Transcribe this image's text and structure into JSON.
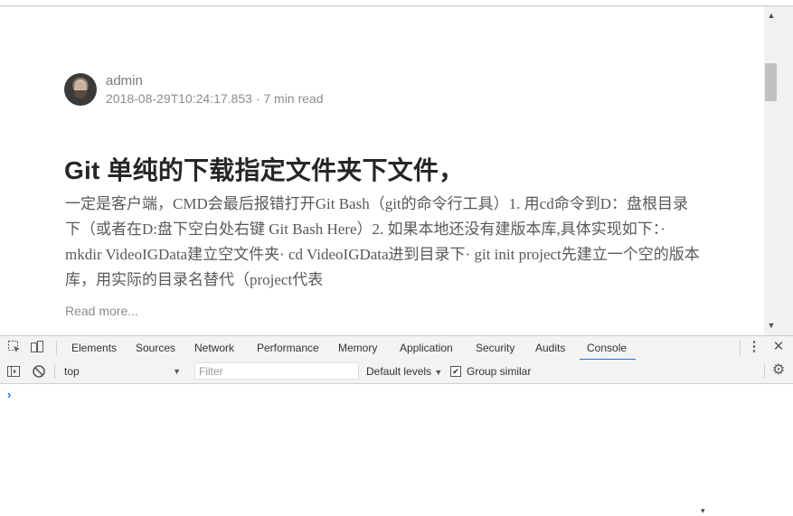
{
  "article": {
    "author": "admin",
    "meta": "2018-08-29T10:24:17.853 · 7 min read",
    "title": "Git 单纯的下载指定文件夹下文件，",
    "excerpt": "一定是客户端，CMD会最后报错打开Git Bash（git的命令行工具）1. 用cd命令到D：盘根目录下（或者在D:盘下空白处右键 Git Bash Here）2. 如果本地还没有建版本库,具体实现如下：· mkdir VideoIGData建立空文件夹· cd VideoIGData进到目录下· git init project先建立一个空的版本库，用实际的目录名替代（project代表",
    "read_more": "Read more..."
  },
  "devtools": {
    "tabs": [
      "Elements",
      "Sources",
      "Network",
      "Performance",
      "Memory",
      "Application",
      "Security",
      "Audits",
      "Console"
    ],
    "active_tab": "Console",
    "icons": {
      "inspect": "inspect-element-icon",
      "device": "device-toolbar-icon",
      "more": "more-vert-icon",
      "close": "close-icon",
      "sidebar": "console-sidebar-icon",
      "clear": "clear-console-icon",
      "settings": "gear-icon"
    },
    "console": {
      "context": "top",
      "filter_placeholder": "Filter",
      "levels": "Default levels",
      "group_similar_label": "Group similar",
      "group_similar_checked": true,
      "prompt": "›"
    }
  },
  "colors": {
    "accent": "#1a73e8",
    "title": "#262626",
    "muted": "#8c8c8c"
  }
}
